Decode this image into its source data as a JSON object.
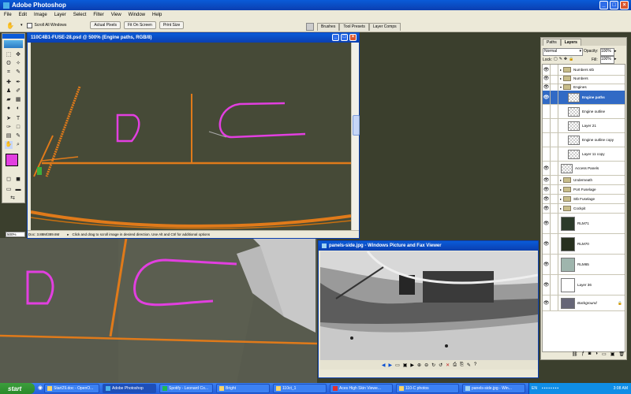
{
  "app": {
    "title": "Adobe Photoshop"
  },
  "menu": [
    "File",
    "Edit",
    "Image",
    "Layer",
    "Select",
    "Filter",
    "View",
    "Window",
    "Help"
  ],
  "options_bar": {
    "scroll_all_label": "Scroll All Windows",
    "buttons": [
      "Actual Pixels",
      "Fit On Screen",
      "Print Size"
    ],
    "palette_tabs": [
      "Brushes",
      "Tool Presets",
      "Layer Comps"
    ]
  },
  "document": {
    "title": "110C4B1-FUSE-28.psd @ 500% (Engine paths, RGB/8)",
    "zoom": "500%",
    "doc_size": "Doc: 3.88M/389.6M",
    "hint": "Click and drag to scroll image in desired direction.  Use Alt and Ctrl for additional options"
  },
  "layers_panel": {
    "tabs": [
      "Paths",
      "Layers"
    ],
    "blend_mode": "Normal",
    "opacity_label": "Opacity:",
    "opacity": "100%",
    "lock_label": "Lock:",
    "fill_label": "Fill:",
    "fill": "100%",
    "layers": [
      {
        "name": "Numbers stb",
        "kind": "group"
      },
      {
        "name": "Numbers",
        "kind": "group"
      },
      {
        "name": "Engines",
        "kind": "group-open"
      },
      {
        "name": "Engine paths",
        "kind": "layer",
        "selected": true
      },
      {
        "name": "Engine outline",
        "kind": "layer"
      },
      {
        "name": "Layer 21",
        "kind": "layer"
      },
      {
        "name": "Engine outline copy",
        "kind": "layer"
      },
      {
        "name": "Layer 11 copy",
        "kind": "layer"
      },
      {
        "name": "Access Panels",
        "kind": "layer"
      },
      {
        "name": "Underneath",
        "kind": "group"
      },
      {
        "name": "Port Fuselage",
        "kind": "group"
      },
      {
        "name": "Stb Fuselage",
        "kind": "group"
      },
      {
        "name": "Cockpit",
        "kind": "group"
      },
      {
        "name": "RLM71",
        "kind": "fill"
      },
      {
        "name": "RLM70",
        "kind": "fill"
      },
      {
        "name": "RLM65",
        "kind": "fill"
      },
      {
        "name": "Layer 36",
        "kind": "layer"
      },
      {
        "name": "Background",
        "kind": "bg"
      }
    ],
    "colors": {
      "RLM71": "#2c3a2a",
      "RLM70": "#27301f",
      "RLM65": "#9fb5ad"
    }
  },
  "viewer": {
    "title": "panels-side.jpg - Windows Picture and Fax Viewer"
  },
  "taskbar": {
    "start": "start",
    "items": [
      "Start29.doc - OpenO...",
      "Adobe Photoshop",
      "Spotify - Leonard Co...",
      "Bright",
      "110ct_1",
      "Aces High Skin Viewe...",
      "110-C photos",
      "panels-side.jpg - Win..."
    ],
    "lang": "EN",
    "clock": "3:08 AM"
  },
  "colors": {
    "accent": "#0a4fd3",
    "path": "#e23fe0",
    "panel_line": "#e07a1a"
  }
}
